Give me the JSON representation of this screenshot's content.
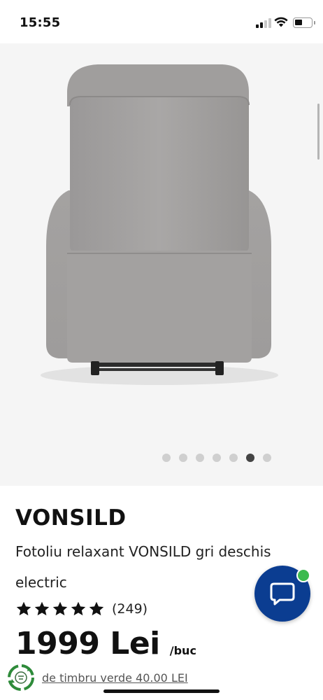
{
  "status_bar": {
    "time": "15:55"
  },
  "gallery": {
    "image_count": 7,
    "active_index": 5,
    "image_alt": "grey recliner armchair, back view"
  },
  "product": {
    "name": "VONSILD",
    "description": "Fotoliu relaxant VONSILD gri deschis electric",
    "rating_stars": 5,
    "review_count": "(249)",
    "price": "1999 Lei",
    "unit": "/buc",
    "eco_tax_text": "de timbru verde 40.00 LEI"
  },
  "icons": {
    "chat": "chat-bubble-icon",
    "eco": "recycle-icon",
    "star": "star-icon"
  },
  "colors": {
    "chat_button": "#0b3d91",
    "chat_badge": "#3cba4e",
    "active_dot": "#444444",
    "inactive_dot": "#cfcfcf"
  }
}
